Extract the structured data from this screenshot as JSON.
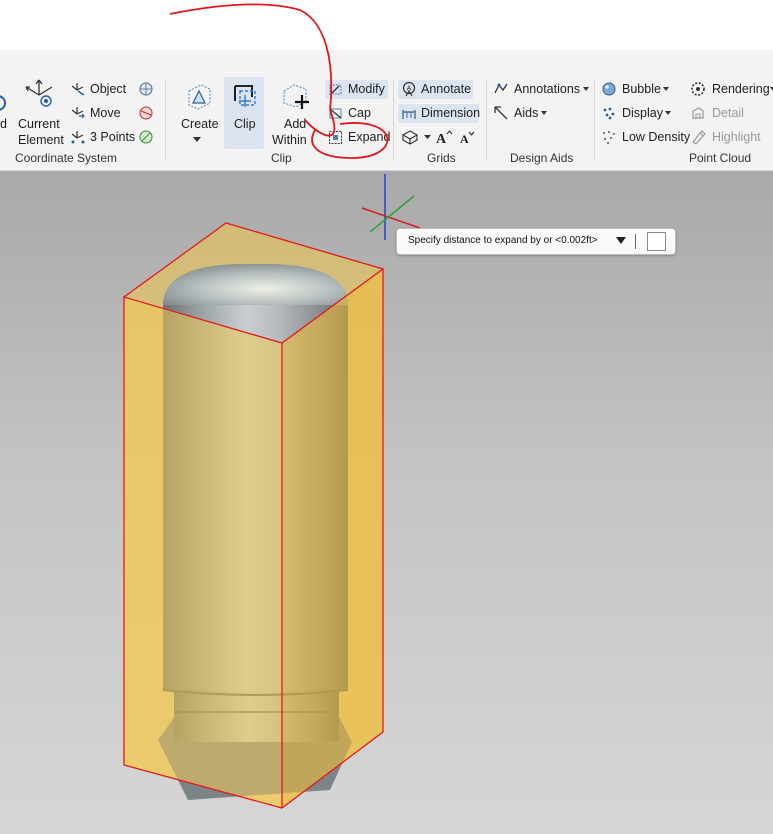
{
  "ribbon": {
    "coordinate_system": {
      "group_label": "Coordinate System",
      "partial_label": "d",
      "current_element": [
        "Current",
        "Element"
      ],
      "object": "Object",
      "move": "Move",
      "three_points": "3 Points"
    },
    "clip": {
      "group_label": "Clip",
      "create": "Create",
      "clip": "Clip",
      "add_within": [
        "Add",
        "Within"
      ],
      "modify": "Modify",
      "cap": "Cap",
      "expand": "Expand"
    },
    "grids": {
      "group_label": "Grids",
      "annotate": "Annotate",
      "dimension": "Dimension"
    },
    "design_aids": {
      "group_label": "Design Aids",
      "annotations": "Annotations",
      "aids": "Aids"
    },
    "point_cloud": {
      "group_label": "Point Cloud",
      "bubble": "Bubble",
      "display": "Display",
      "low_density": "Low Density",
      "rendering": "Rendering",
      "detail": "Detail",
      "highlight": "Highlight"
    }
  },
  "prompt": {
    "text": "Specify distance to expand by or <0.002ft>",
    "input_value": ""
  },
  "colors": {
    "annotation_red": "#e0191c",
    "clip_box_fill": "#f0c64a",
    "clip_box_edge": "#e21b1b",
    "ribbon_bg": "#f3f3f3",
    "selected_tool_bg": "#dde4f1"
  }
}
